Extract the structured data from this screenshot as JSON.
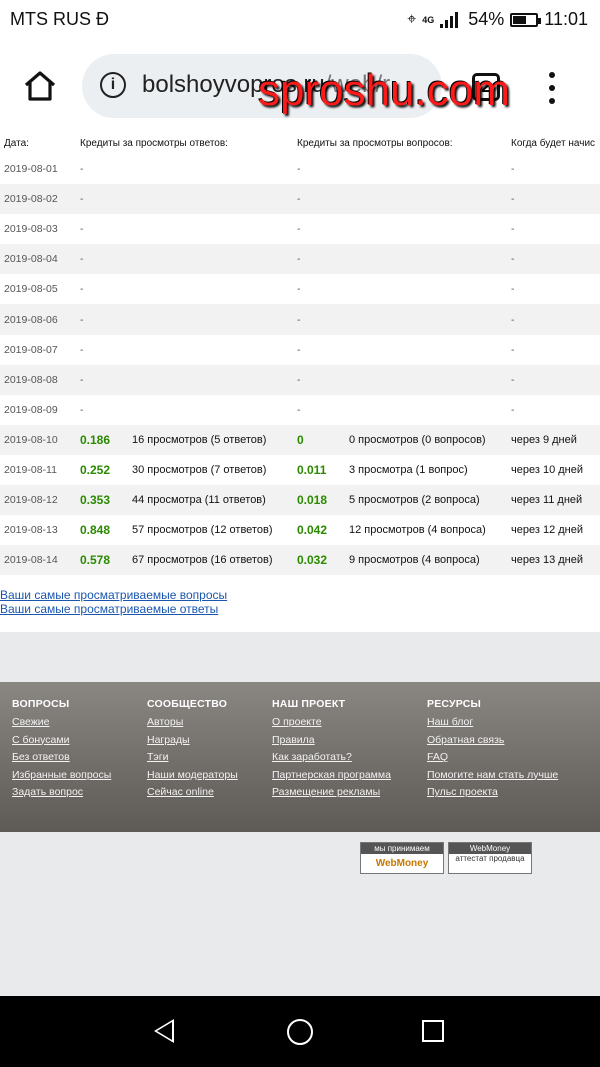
{
  "status_bar": {
    "carrier": "MTS RUS Đ",
    "network": "4G",
    "battery": "54%",
    "time": "11:01"
  },
  "browser": {
    "url_domain": "bolshoyvopros.ru",
    "url_path": "/web/r",
    "tab_count": "2",
    "watermark": "sproshu.com",
    "icons": [
      "home-icon",
      "info-icon",
      "tabs-icon",
      "menu-icon"
    ]
  },
  "table": {
    "headers": [
      "Дата:",
      "Кредиты за просмотры ответов:",
      "",
      "Кредиты за просмотры вопросов:",
      "",
      "Когда будет начис"
    ],
    "rows": [
      {
        "date": "2019-08-01",
        "ans_val": "-",
        "ans_txt": "",
        "q_val": "-",
        "q_txt": "",
        "when": "-"
      },
      {
        "date": "2019-08-02",
        "ans_val": "-",
        "ans_txt": "",
        "q_val": "-",
        "q_txt": "",
        "when": "-"
      },
      {
        "date": "2019-08-03",
        "ans_val": "-",
        "ans_txt": "",
        "q_val": "-",
        "q_txt": "",
        "when": "-"
      },
      {
        "date": "2019-08-04",
        "ans_val": "-",
        "ans_txt": "",
        "q_val": "-",
        "q_txt": "",
        "when": "-"
      },
      {
        "date": "2019-08-05",
        "ans_val": "-",
        "ans_txt": "",
        "q_val": "-",
        "q_txt": "",
        "when": "-"
      },
      {
        "date": "2019-08-06",
        "ans_val": "-",
        "ans_txt": "",
        "q_val": "-",
        "q_txt": "",
        "when": "-"
      },
      {
        "date": "2019-08-07",
        "ans_val": "-",
        "ans_txt": "",
        "q_val": "-",
        "q_txt": "",
        "when": "-"
      },
      {
        "date": "2019-08-08",
        "ans_val": "-",
        "ans_txt": "",
        "q_val": "-",
        "q_txt": "",
        "when": "-"
      },
      {
        "date": "2019-08-09",
        "ans_val": "-",
        "ans_txt": "",
        "q_val": "-",
        "q_txt": "",
        "when": "-"
      },
      {
        "date": "2019-08-10",
        "ans_val": "0.186",
        "ans_txt": "16 просмотров (5 ответов)",
        "q_val": "0",
        "q_txt": "0 просмотров (0 вопросов)",
        "when": "через 9 дней"
      },
      {
        "date": "2019-08-11",
        "ans_val": "0.252",
        "ans_txt": "30 просмотров (7 ответов)",
        "q_val": "0.011",
        "q_txt": "3 просмотра (1 вопрос)",
        "when": "через 10 дней"
      },
      {
        "date": "2019-08-12",
        "ans_val": "0.353",
        "ans_txt": "44 просмотра (11 ответов)",
        "q_val": "0.018",
        "q_txt": "5 просмотров (2 вопроса)",
        "when": "через 11 дней"
      },
      {
        "date": "2019-08-13",
        "ans_val": "0.848",
        "ans_txt": "57 просмотров (12 ответов)",
        "q_val": "0.042",
        "q_txt": "12 просмотров (4 вопроса)",
        "when": "через 12 дней"
      },
      {
        "date": "2019-08-14",
        "ans_val": "0.578",
        "ans_txt": "67 просмотров (16 ответов)",
        "q_val": "0.032",
        "q_txt": "9 просмотров (4 вопроса)",
        "when": "через 13 дней"
      }
    ]
  },
  "links": {
    "top_questions": "Ваши самые просматриваемые вопросы",
    "top_answers": "Ваши самые просматриваемые ответы"
  },
  "footer": {
    "columns": [
      {
        "heading": "ВОПРОСЫ",
        "items": [
          "Свежие",
          "С бонусами",
          "Без ответов",
          "Избранные вопросы",
          "Задать вопрос"
        ]
      },
      {
        "heading": "СООБЩЕСТВО",
        "items": [
          "Авторы",
          "Награды",
          "Тэги",
          "Наши модераторы",
          "Сейчас online"
        ]
      },
      {
        "heading": "НАШ ПРОЕКТ",
        "items": [
          "О проекте",
          "Правила",
          "Как заработать?",
          "Партнерская программа",
          "Размещение рекламы"
        ]
      },
      {
        "heading": "РЕСУРСЫ",
        "items": [
          "Наш блог",
          "Обратная связь",
          "FAQ",
          "Помогите нам стать лучше",
          "Пульс проекта"
        ]
      }
    ],
    "badges": [
      {
        "top": "мы принимаем",
        "bottom": "WebMoney"
      },
      {
        "top": "WebMoney",
        "bottom": "аттестат продавца"
      }
    ]
  },
  "nav": {
    "icons": [
      "back-icon",
      "home-circle-icon",
      "recents-icon"
    ]
  },
  "colors": {
    "value_green": "#2a8a00",
    "link_blue": "#1a56b0",
    "watermark_red": "#ff1a1a",
    "footer_bg": "#7a7672"
  }
}
